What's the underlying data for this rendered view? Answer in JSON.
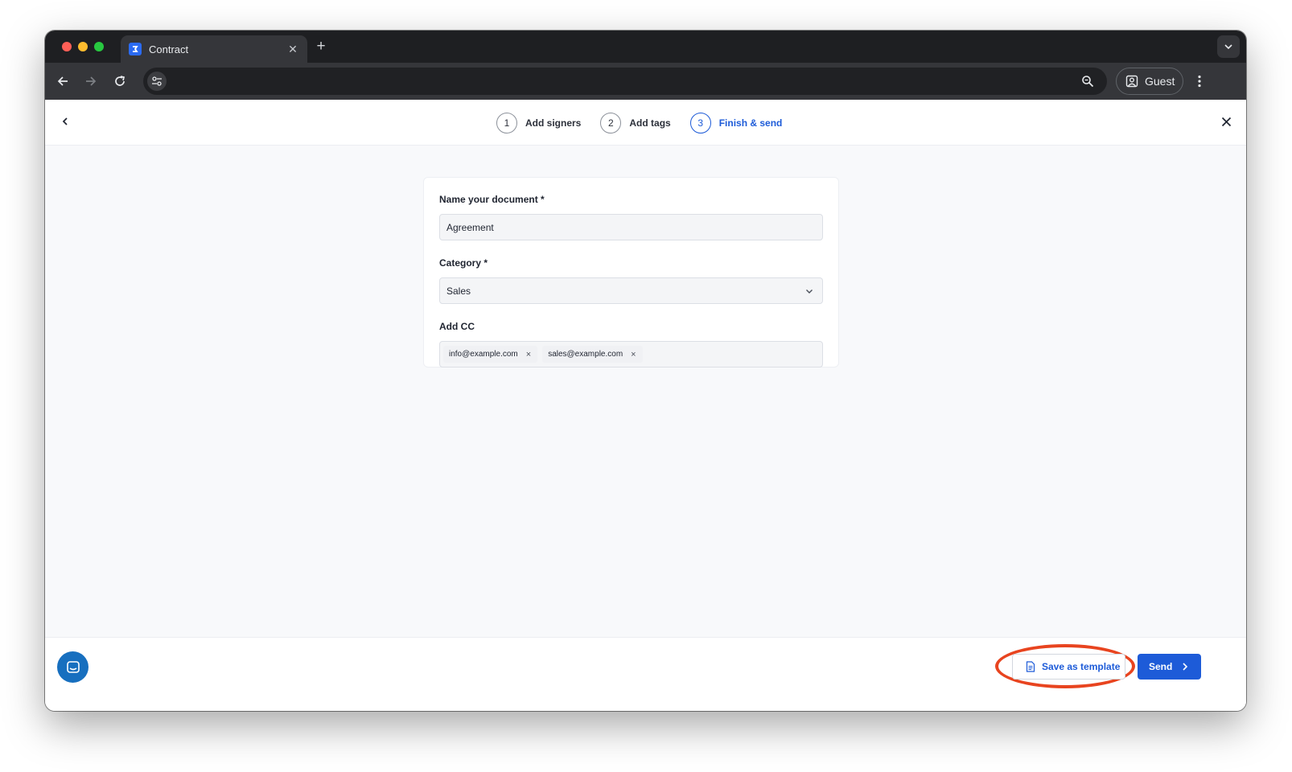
{
  "browser": {
    "tab_title": "Contract",
    "tab_close_symbol": "✕",
    "new_tab_symbol": "+",
    "profile_label": "Guest"
  },
  "wizard": {
    "steps": [
      {
        "number": "1",
        "label": "Add signers",
        "active": false
      },
      {
        "number": "2",
        "label": "Add tags",
        "active": false
      },
      {
        "number": "3",
        "label": "Finish & send",
        "active": true
      }
    ]
  },
  "form": {
    "name_label": "Name your document *",
    "name_value": "Agreement",
    "category_label": "Category *",
    "category_value": "Sales",
    "cc_label": "Add CC",
    "cc_chips": [
      "info@example.com",
      "sales@example.com"
    ],
    "chip_remove_symbol": "×"
  },
  "footer": {
    "save_template_label": "Save as template",
    "send_label": "Send"
  },
  "colors": {
    "accent": "#1d5bd8",
    "chat_button": "#176fbf",
    "annotation": "#e8441f"
  }
}
